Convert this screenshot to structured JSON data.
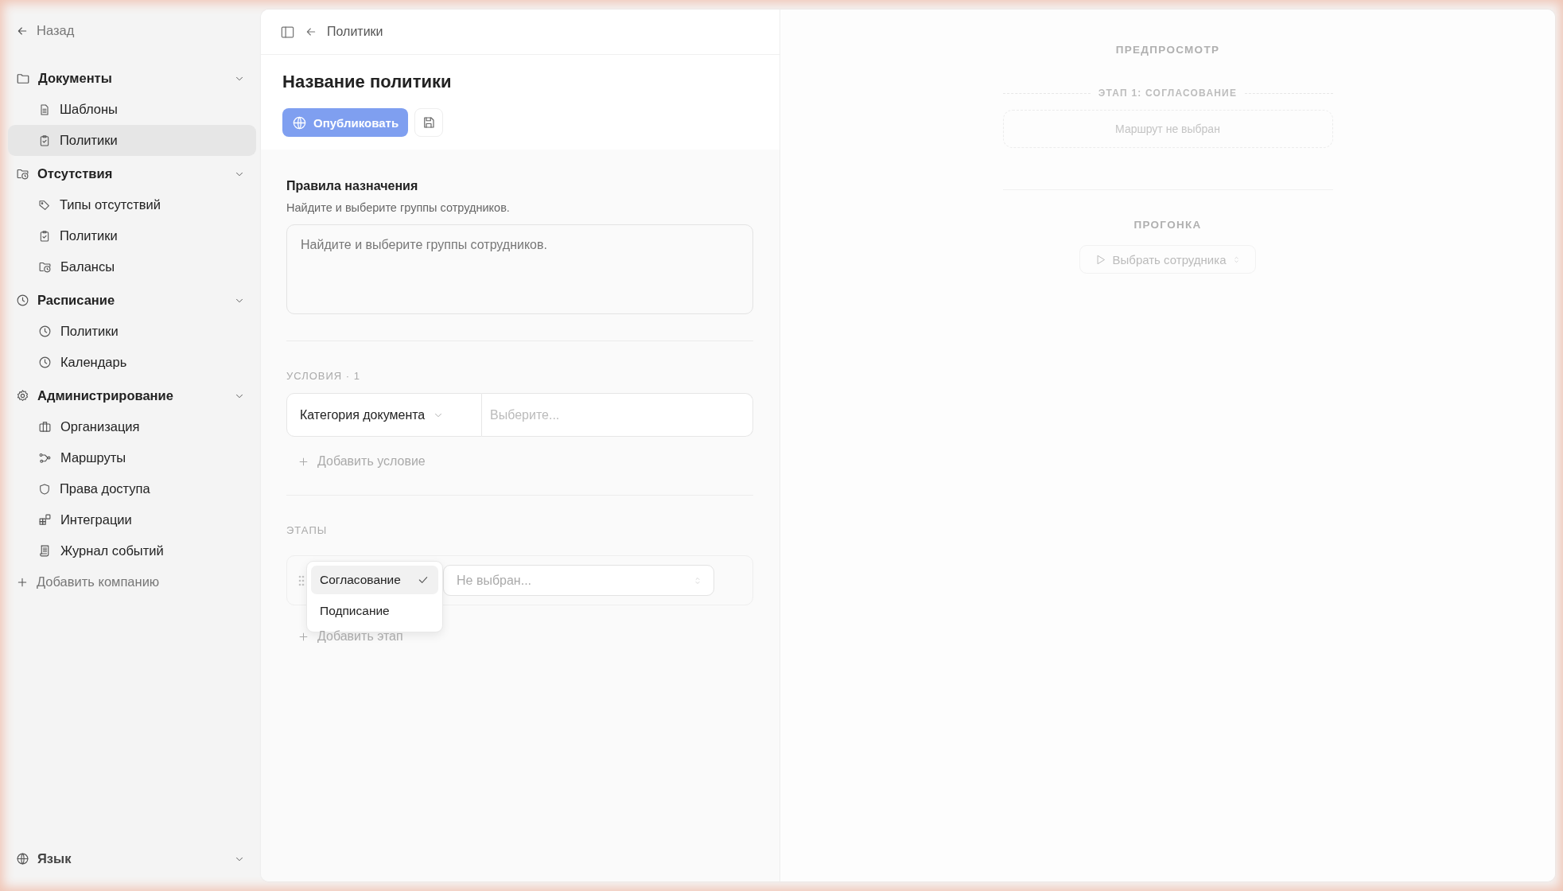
{
  "sidebar": {
    "back": "Назад",
    "groups": [
      {
        "label": "Документы",
        "expanded": true,
        "items": [
          {
            "label": "Шаблоны",
            "selected": false
          },
          {
            "label": "Политики",
            "selected": true
          }
        ]
      },
      {
        "label": "Отсутствия",
        "expanded": true,
        "items": [
          {
            "label": "Типы отсутствий",
            "selected": false
          },
          {
            "label": "Политики",
            "selected": false
          },
          {
            "label": "Балансы",
            "selected": false
          }
        ]
      },
      {
        "label": "Расписание",
        "expanded": true,
        "items": [
          {
            "label": "Политики",
            "selected": false
          },
          {
            "label": "Календарь",
            "selected": false
          }
        ]
      },
      {
        "label": "Администрирование",
        "expanded": true,
        "items": [
          {
            "label": "Организация",
            "selected": false
          },
          {
            "label": "Маршруты",
            "selected": false
          },
          {
            "label": "Права доступа",
            "selected": false
          },
          {
            "label": "Интеграции",
            "selected": false
          },
          {
            "label": "Журнал событий",
            "selected": false
          }
        ]
      }
    ],
    "add_company": "Добавить компанию",
    "language": "Язык"
  },
  "breadcrumb": "Политики",
  "title": "Название политики",
  "publish_button": "Опубликовать",
  "assignment": {
    "title": "Правила назначения",
    "hint": "Найдите и выберите группы сотрудников.",
    "placeholder": "Найдите и выберите группы сотрудников."
  },
  "conditions": {
    "heading": "УСЛОВИЯ · 1",
    "rows": [
      {
        "field": "Категория документа",
        "placeholder": "Выберите..."
      }
    ],
    "add": "Добавить условие"
  },
  "stages": {
    "heading": "ЭТАПЫ",
    "rows": [
      {
        "route_placeholder": "Не выбран..."
      }
    ],
    "add": "Добавить этап",
    "dropdown": {
      "options": [
        {
          "label": "Согласование",
          "selected": true
        },
        {
          "label": "Подписание",
          "selected": false
        }
      ]
    }
  },
  "preview": {
    "title": "ПРЕДПРОСМОТР",
    "stage_title": "ЭТАП 1: СОГЛАСОВАНИЕ",
    "stage_empty": "Маршрут не выбран",
    "run_title": "ПРОГОНКА",
    "run_button": "Выбрать сотрудника"
  }
}
